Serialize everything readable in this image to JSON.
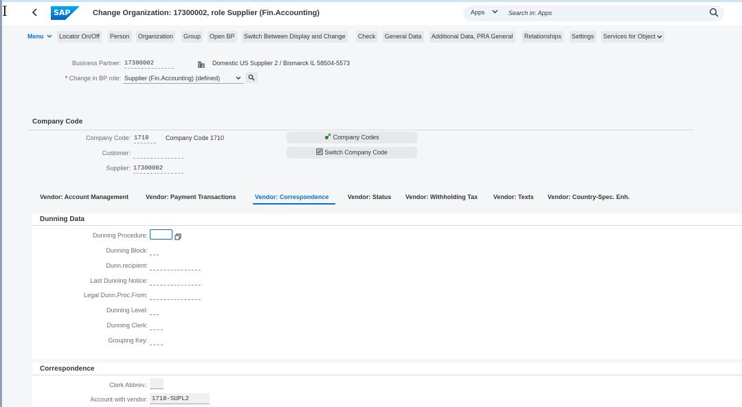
{
  "shell": {
    "title": "Change Organization: 17300002, role Supplier (Fin.Accounting)",
    "apps_label": "Apps",
    "search_placeholder": "Search in: Apps",
    "brand": "SAP"
  },
  "toolbar": {
    "menu_label": "Menu",
    "buttons": [
      "Locator On/Off",
      "Person",
      "Organization",
      "Group",
      "Open BP",
      "Switch Between Display and Change",
      "Check",
      "General Data",
      "Additional Data, PRA General",
      "Relationships",
      "Settings",
      "Services for Object"
    ]
  },
  "header": {
    "bp_label": "Business Partner:",
    "bp_value": "17300002",
    "bp_description": "Domestic US Supplier 2 / Bismarck IL 58504-5573",
    "role_label_req": "*",
    "role_label": "Change in BP role:",
    "role_value": "Supplier (Fin.Accounting) (defined)"
  },
  "company_code": {
    "section_title": "Company Code",
    "cc_label": "Company Code:",
    "cc_value": "1710",
    "cc_description": "Company Code 1710",
    "customer_label": "Customer:",
    "customer_value": "",
    "supplier_label": "Supplier:",
    "supplier_value": "17300002",
    "btn_company_codes": "Company Codes",
    "btn_switch_company_code": "Switch Company Code"
  },
  "tabs": [
    "Vendor: Account Management",
    "Vendor: Payment Transactions",
    "Vendor: Correspondence",
    "Vendor: Status",
    "Vendor: Withholding Tax",
    "Vendor: Texts",
    "Vendor: Country-Spec. Enh."
  ],
  "active_tab": "Vendor: Correspondence",
  "dunning": {
    "section_title": "Dunning Data",
    "fields": [
      "Dunning Procedure:",
      "Dunning Block:",
      "Dunn.recipient:",
      "Last Dunning Notice:",
      "Legal Dunn.Proc.From:",
      "Dunning Level:",
      "Dunning Clerk:",
      "Grouping Key:"
    ]
  },
  "correspondence": {
    "section_title": "Correspondence",
    "clerk_label": "Clerk Abbrev.:",
    "clerk_value": "",
    "account_label": "Account with vendor:",
    "account_value": "1710-SUPL2"
  },
  "colors": {
    "accent": "#0a6ed1",
    "button_bg": "#e6e8eb",
    "page_bg": "#f5f6f7",
    "sap_blue": "#0b74de"
  }
}
